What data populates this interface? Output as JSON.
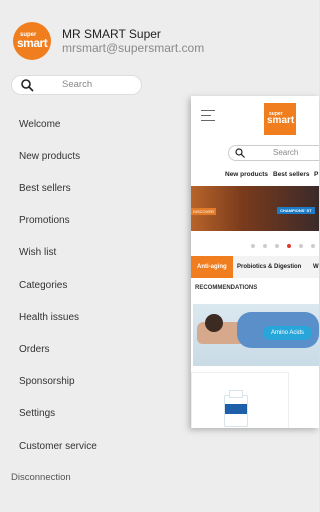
{
  "user": {
    "name": "MR SMART Super",
    "email": "mrsmart@supersmart.com",
    "logo_super": "super",
    "logo_smart": "smart"
  },
  "search": {
    "placeholder": "Search"
  },
  "menu": [
    "Welcome",
    "New products",
    "Best sellers",
    "Promotions",
    "Wish list",
    "Categories",
    "Health issues",
    "Orders",
    "Sponsorship",
    "Settings",
    "Customer service"
  ],
  "disconnection": "Disconnection",
  "preview": {
    "search_placeholder": "Search",
    "tabs": [
      "New products",
      "Best sellers",
      "P"
    ],
    "banner_left": "DISCOVER",
    "banner_right": "CHAMPIONS' ST",
    "categories": [
      "Anti-aging",
      "Probiotics & Digestion",
      "W"
    ],
    "recommendations": "RECOMMENDATIONS",
    "product_label": "Amino Acids"
  },
  "colors": {
    "brand": "#f07d1e",
    "accent": "#29a6d9"
  }
}
